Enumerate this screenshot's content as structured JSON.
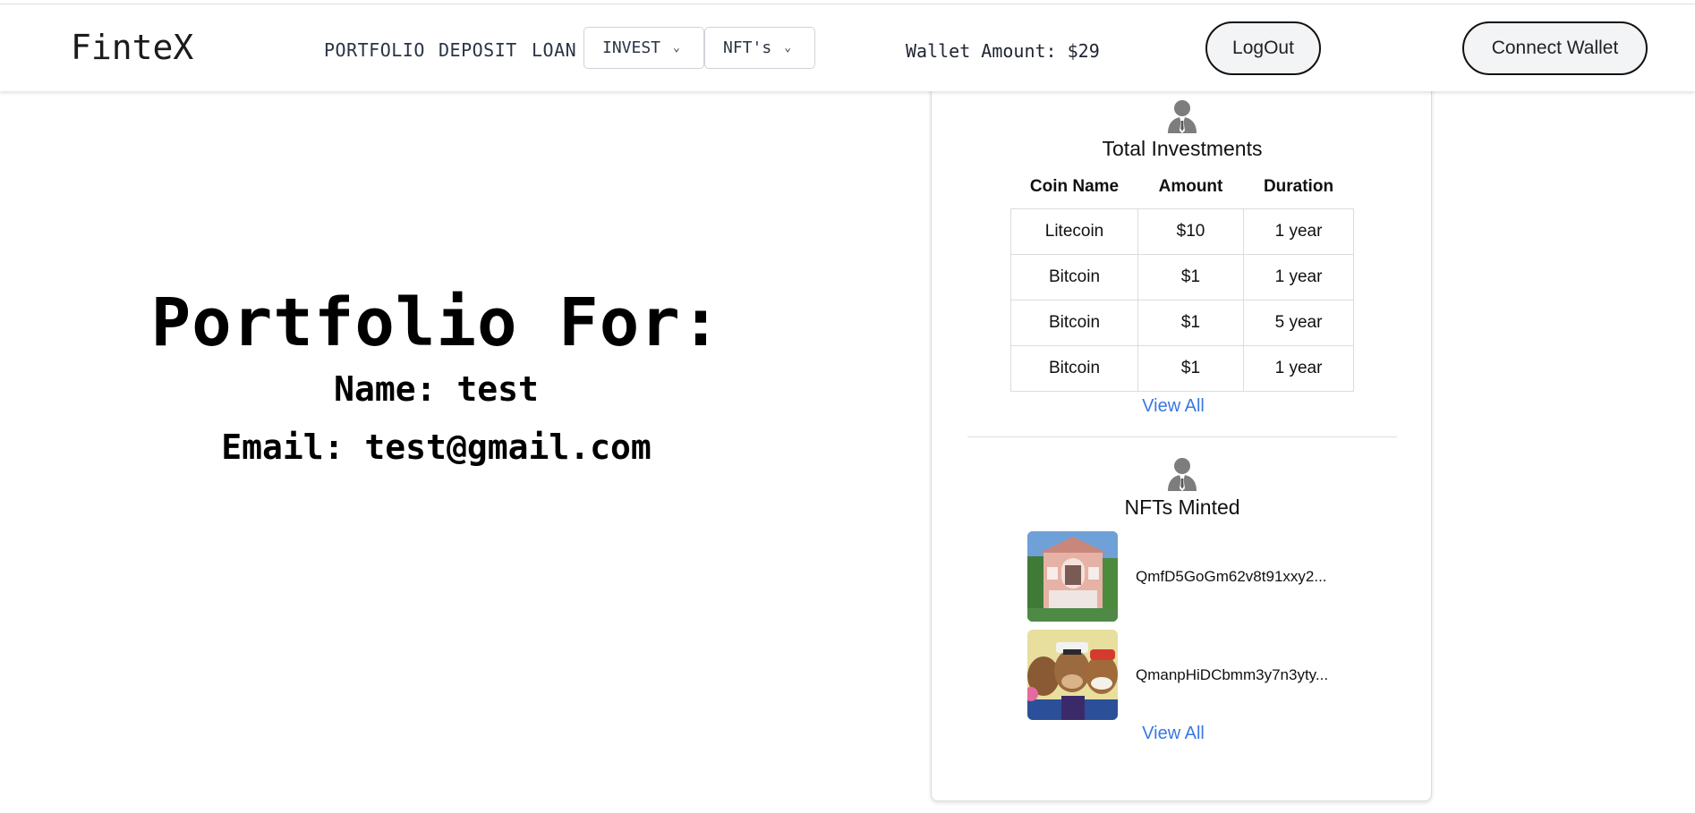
{
  "navbar": {
    "brand": "FinteX",
    "links": [
      "PORTFOLIO",
      "DEPOSIT",
      "LOAN"
    ],
    "dropdowns": [
      "INVEST",
      "NFT's"
    ],
    "wallet_amount": "Wallet Amount: $29",
    "logout_label": "LogOut",
    "connect_wallet_label": "Connect Wallet"
  },
  "portfolio": {
    "title": "Portfolio For:",
    "name_line": "Name: test",
    "email_line": "Email: test@gmail.com"
  },
  "investments": {
    "title": "Total Investments",
    "columns": [
      "Coin Name",
      "Amount",
      "Duration"
    ],
    "rows": [
      [
        "Litecoin",
        "$10",
        "1 year"
      ],
      [
        "Bitcoin",
        "$1",
        "1 year"
      ],
      [
        "Bitcoin",
        "$1",
        "5 year"
      ],
      [
        "Bitcoin",
        "$1",
        "1 year"
      ]
    ],
    "view_all": "View All"
  },
  "nfts": {
    "title": "NFTs Minted",
    "items": [
      {
        "hash": "QmfD5GoGm62v8t91xxy2..."
      },
      {
        "hash": "QmanpHiDCbmm3y7n3yty..."
      }
    ],
    "view_all": "View All"
  },
  "colors": {
    "link_blue": "#3a78e0",
    "nav_text": "#2b3445"
  }
}
